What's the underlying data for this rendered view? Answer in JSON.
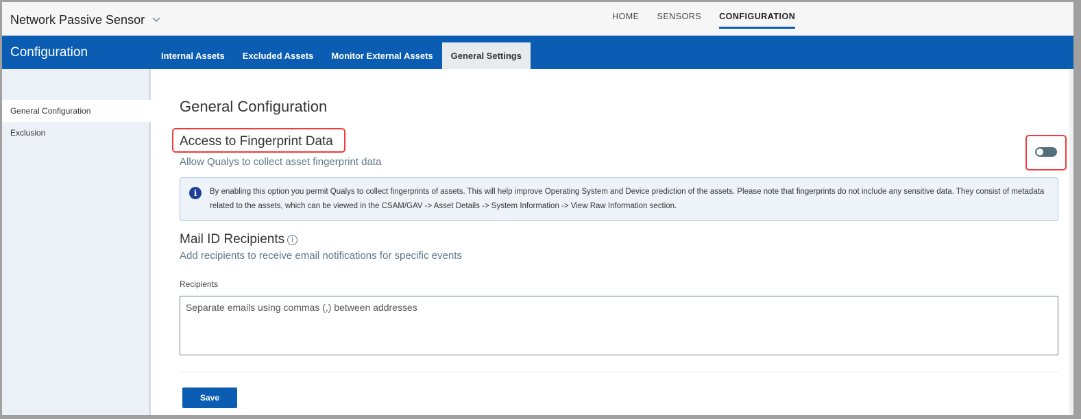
{
  "header": {
    "app_title": "Network Passive Sensor",
    "nav": [
      "HOME",
      "SENSORS",
      "CONFIGURATION"
    ],
    "active_nav": "CONFIGURATION"
  },
  "section": {
    "title": "Configuration",
    "tabs": [
      "Internal Assets",
      "Excluded Assets",
      "Monitor External Assets",
      "General Settings"
    ],
    "active_tab": "General Settings"
  },
  "sidebar": {
    "items": [
      "General Configuration",
      "Exclusion"
    ]
  },
  "main": {
    "title": "General Configuration",
    "fingerprint": {
      "title": "Access to Fingerprint Data",
      "subtitle": "Allow Qualys to collect asset fingerprint data",
      "enabled": false,
      "info": "By enabling this option you permit Qualys to collect fingerprints of assets. This will help improve Operating System and Device prediction of the assets. Please note that fingerprints do not include any sensitive data. They consist of metadata related to the assets, which can be viewed in the CSAM/GAV -> Asset Details -> System Information -> View Raw Information section."
    },
    "mail": {
      "title": "Mail ID Recipients",
      "subtitle": "Add recipients to receive email notifications for specific events",
      "label": "Recipients",
      "placeholder": "Separate emails using commas (,) between addresses",
      "value": ""
    },
    "save_label": "Save"
  },
  "colors": {
    "brand": "#0b5db3",
    "highlight": "#ee3b3b"
  }
}
